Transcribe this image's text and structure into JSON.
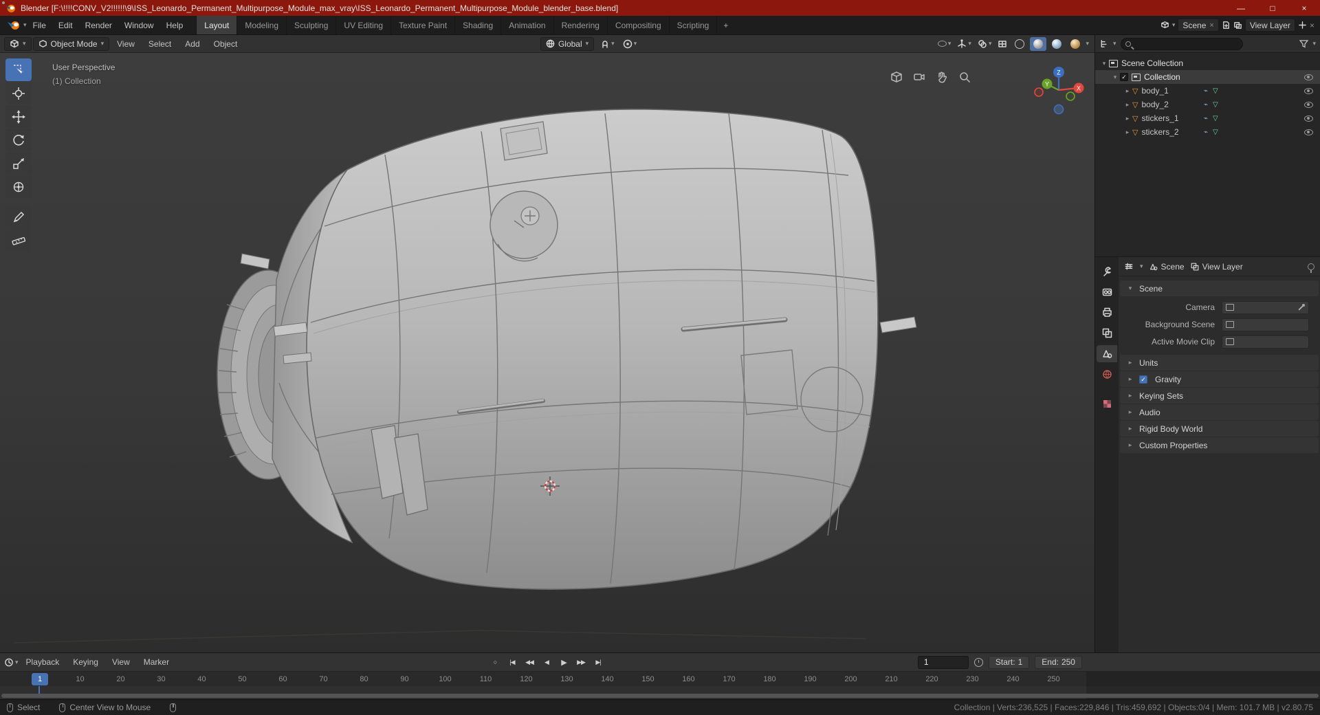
{
  "window": {
    "title": "Blender [F:\\!!!!CONV_V2!!!!!!\\9\\ISS_Leonardo_Permanent_Multipurpose_Module_max_vray\\ISS_Leonardo_Permanent_Multipurpose_Module_blender_base.blend]",
    "controls": {
      "minimize": "—",
      "maximize": "□",
      "close": "×"
    }
  },
  "icons": {
    "dropdown": "▾",
    "tree_open": "▾",
    "tree_closed": "▸",
    "close": "×",
    "add": "+",
    "check": "✓",
    "autokey": "○",
    "jump_start": "|◀",
    "prev_key": "◀◀",
    "play_rev": "◀",
    "play": "▶",
    "next_key": "▶▶",
    "jump_end": "▶|",
    "mesh_triangle": "▽",
    "wrench": "⌁",
    "data_triangle": "▽"
  },
  "topbar": {
    "menus": [
      {
        "label": "File"
      },
      {
        "label": "Edit"
      },
      {
        "label": "Render"
      },
      {
        "label": "Window"
      },
      {
        "label": "Help"
      }
    ],
    "workspaces": [
      {
        "label": "Layout"
      },
      {
        "label": "Modeling"
      },
      {
        "label": "Sculpting"
      },
      {
        "label": "UV Editing"
      },
      {
        "label": "Texture Paint"
      },
      {
        "label": "Shading"
      },
      {
        "label": "Animation"
      },
      {
        "label": "Rendering"
      },
      {
        "label": "Compositing"
      },
      {
        "label": "Scripting"
      }
    ],
    "scene": {
      "label": "Scene"
    },
    "view_layer": {
      "label": "View Layer"
    }
  },
  "viewport": {
    "header": {
      "mode": "Object Mode",
      "menus": [
        {
          "label": "View"
        },
        {
          "label": "Select"
        },
        {
          "label": "Add"
        },
        {
          "label": "Object"
        }
      ],
      "orientation": "Global"
    },
    "overlay": {
      "perspective": "User Perspective",
      "collection": "(1) Collection"
    },
    "gizmo_axes": {
      "x": "X",
      "y": "Y",
      "z": "Z"
    }
  },
  "outliner": {
    "root": "Scene Collection",
    "collection": "Collection",
    "items": [
      {
        "name": "body_1"
      },
      {
        "name": "body_2"
      },
      {
        "name": "stickers_1"
      },
      {
        "name": "stickers_2"
      }
    ]
  },
  "properties": {
    "breadcrumb": {
      "scene": "Scene",
      "view_layer": "View Layer"
    },
    "scene_panel": {
      "title": "Scene",
      "fields": [
        {
          "label": "Camera"
        },
        {
          "label": "Background Scene"
        },
        {
          "label": "Active Movie Clip"
        }
      ]
    },
    "panels": [
      {
        "label": "Units"
      },
      {
        "label": "Gravity"
      },
      {
        "label": "Keying Sets"
      },
      {
        "label": "Audio"
      },
      {
        "label": "Rigid Body World"
      },
      {
        "label": "Custom Properties"
      }
    ]
  },
  "timeline": {
    "menus": [
      {
        "label": "Playback"
      },
      {
        "label": "Keying"
      },
      {
        "label": "View"
      },
      {
        "label": "Marker"
      }
    ],
    "current_frame": "1",
    "start_label": "Start:",
    "start_value": "1",
    "end_label": "End:",
    "end_value": "250",
    "ticks": [
      "1",
      "10",
      "20",
      "30",
      "40",
      "50",
      "60",
      "70",
      "80",
      "90",
      "100",
      "110",
      "120",
      "130",
      "140",
      "150",
      "160",
      "170",
      "180",
      "190",
      "200",
      "210",
      "220",
      "230",
      "240",
      "250"
    ]
  },
  "statusbar": {
    "select": "Select",
    "center_view": "Center View to Mouse",
    "stats": "Collection | Verts:236,525 | Faces:229,846 | Tris:459,692 | Objects:0/4 | Mem: 101.7 MB | v2.80.75"
  },
  "colors": {
    "accent": "#4772b3",
    "mesh_icon": "#e8963c",
    "axis_x": "#e2483d",
    "axis_y": "#6ba32a",
    "axis_z": "#3b6fc1",
    "titlebar": "#8b170d"
  }
}
